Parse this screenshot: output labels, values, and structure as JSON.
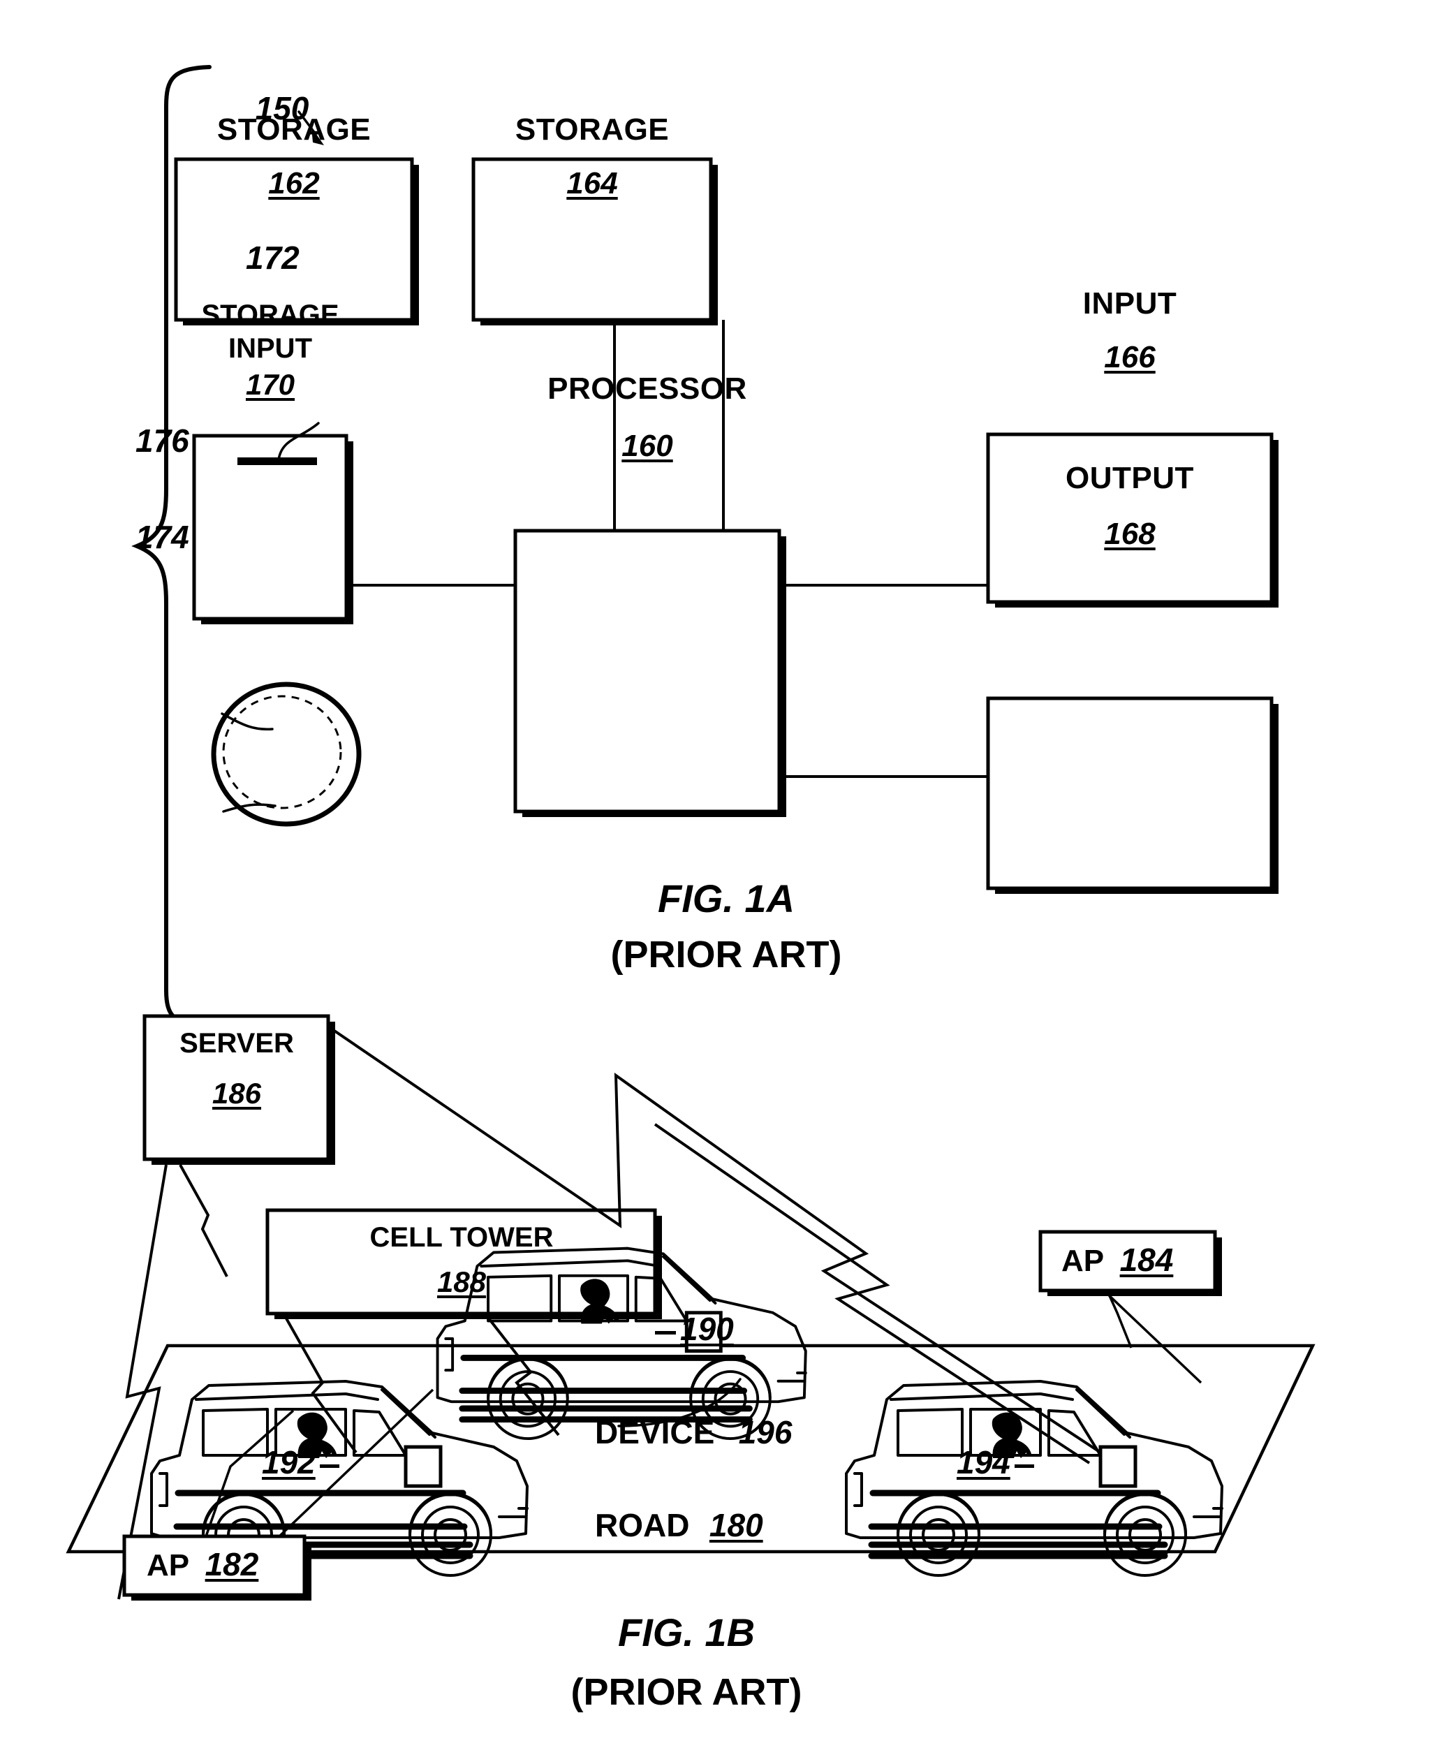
{
  "figure_1a": {
    "system_ref": "150",
    "blocks": [
      {
        "id": "storage-162",
        "label": "STORAGE",
        "ref": "162"
      },
      {
        "id": "storage-164",
        "label": "STORAGE",
        "ref": "164"
      },
      {
        "id": "storage-input-170",
        "label_line1": "STORAGE",
        "label_line2": "INPUT",
        "ref": "170"
      },
      {
        "id": "processor-160",
        "label": "PROCESSOR",
        "ref": "160"
      },
      {
        "id": "input-166",
        "label": "INPUT",
        "ref": "166"
      },
      {
        "id": "output-168",
        "label": "OUTPUT",
        "ref": "168"
      }
    ],
    "callouts": [
      {
        "id": "slot-172",
        "ref": "172"
      },
      {
        "id": "disc-outer-174",
        "ref": "174"
      },
      {
        "id": "disc-inner-176",
        "ref": "176"
      }
    ],
    "caption": "FIG. 1A",
    "caption_sub": "(PRIOR ART)"
  },
  "figure_1b": {
    "blocks": [
      {
        "id": "server-186",
        "label": "SERVER",
        "ref": "186"
      },
      {
        "id": "cell-tower-188",
        "label": "CELL TOWER",
        "ref": "188"
      },
      {
        "id": "ap-182",
        "label": "AP",
        "ref": "182"
      },
      {
        "id": "ap-184",
        "label": "AP",
        "ref": "184"
      }
    ],
    "scene_labels": [
      {
        "id": "device-196",
        "label": "DEVICE",
        "ref": "196"
      },
      {
        "id": "road-180",
        "label": "ROAD",
        "ref": "180"
      }
    ],
    "vehicles": [
      {
        "id": "car-190",
        "ref": "190"
      },
      {
        "id": "car-192",
        "ref": "192"
      },
      {
        "id": "car-194",
        "ref": "194"
      }
    ],
    "caption": "FIG. 1B",
    "caption_sub": "(PRIOR ART)"
  },
  "colors": {
    "ink": "#000000",
    "paper": "#ffffff"
  }
}
